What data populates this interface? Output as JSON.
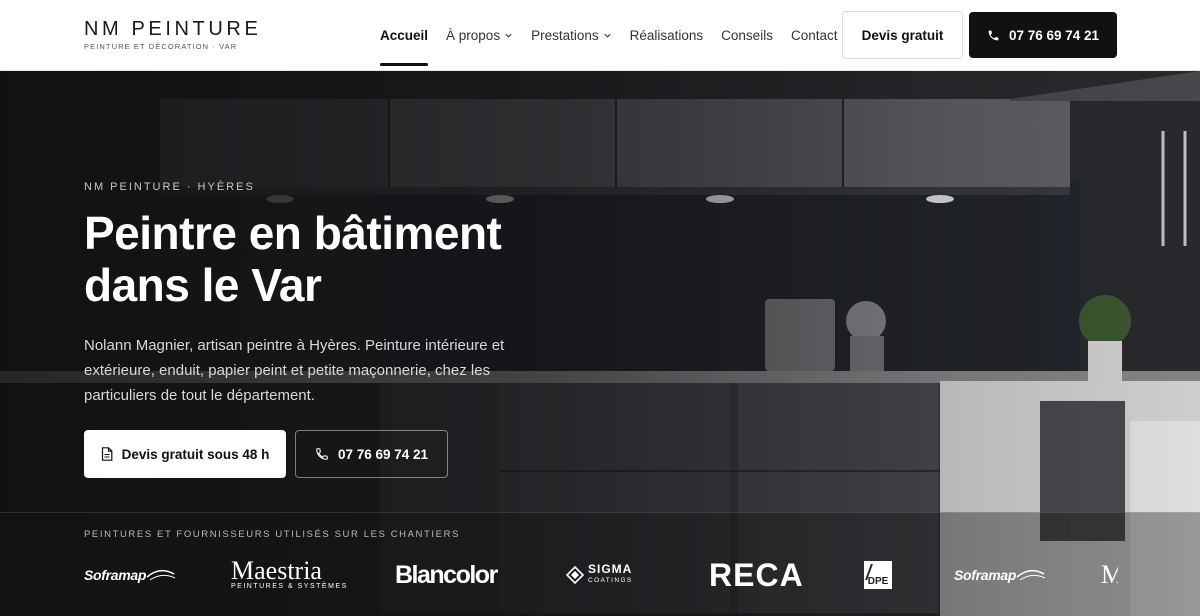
{
  "brand": {
    "name": "NM PEINTURE",
    "tagline": "PEINTURE ET DÉCORATION · VAR"
  },
  "nav": {
    "items": [
      {
        "label": "Accueil",
        "active": true,
        "has_dropdown": false
      },
      {
        "label": "À propos",
        "active": false,
        "has_dropdown": true
      },
      {
        "label": "Prestations",
        "active": false,
        "has_dropdown": true
      },
      {
        "label": "Réalisations",
        "active": false,
        "has_dropdown": false
      },
      {
        "label": "Conseils",
        "active": false,
        "has_dropdown": false
      },
      {
        "label": "Contact",
        "active": false,
        "has_dropdown": false
      }
    ],
    "quote_button": "Devis gratuit",
    "phone_button": "07 76 69 74 21"
  },
  "hero": {
    "eyebrow": "NM PEINTURE · HYÈRES",
    "title_line1": "Peintre en bâtiment",
    "title_line2": "dans le Var",
    "text": "Nolann Magnier, artisan peintre à Hyères. Peinture intérieure et extérieure, enduit, papier peint et petite maçonnerie, chez les particuliers de tout le département.",
    "cta_primary": "Devis gratuit sous 48 h",
    "cta_secondary": "07 76 69 74 21"
  },
  "suppliers": {
    "label": "PEINTURES ET FOURNISSEURS UTILISÉS SUR LES CHANTIERS",
    "logos": [
      {
        "name": "Soframap",
        "text": "Soframap"
      },
      {
        "name": "Maestria",
        "text": "Maestria",
        "sub": "PEINTURES & SYSTÈMES"
      },
      {
        "name": "Blancolor",
        "text": "Blancolor"
      },
      {
        "name": "Sigma",
        "text": "SIGMA",
        "sub": "COATINGS"
      },
      {
        "name": "RECA",
        "text": "RECA"
      },
      {
        "name": "DPE",
        "text": "DPE"
      },
      {
        "name": "Soframap",
        "text": "Soframap"
      },
      {
        "name": "Maestria",
        "text": "M"
      }
    ]
  },
  "colors": {
    "primary": "#111111",
    "header_bg": "#ffffff",
    "hero_text": "#ffffff"
  }
}
